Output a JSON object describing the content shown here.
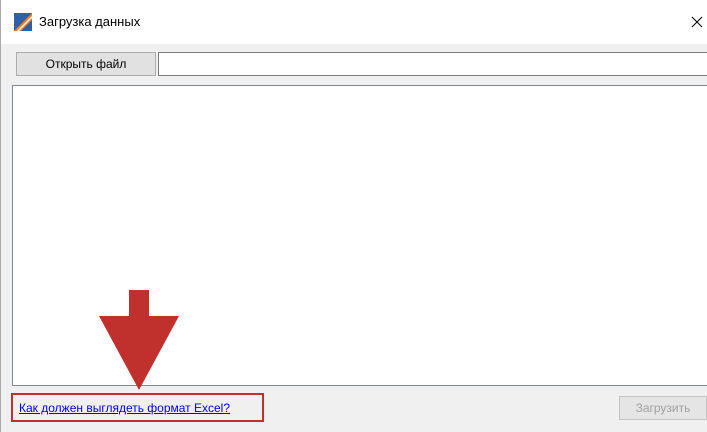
{
  "window": {
    "title": "Загрузка данных",
    "close_glyph": "✕"
  },
  "toolbar": {
    "open_file_label": "Открыть файл",
    "file_path_value": ""
  },
  "footer": {
    "help_link_label": "Как должен выглядеть формат Excel?",
    "upload_label": "Загрузить"
  },
  "colors": {
    "annotation_red": "#c0312e",
    "link_blue": "#0000ee",
    "icon_orange": "#f07f1d",
    "icon_blue": "#2f5fa6"
  },
  "icons": {
    "app": "app-logo-icon",
    "close": "close-icon",
    "annotation": "arrow-down-icon"
  }
}
